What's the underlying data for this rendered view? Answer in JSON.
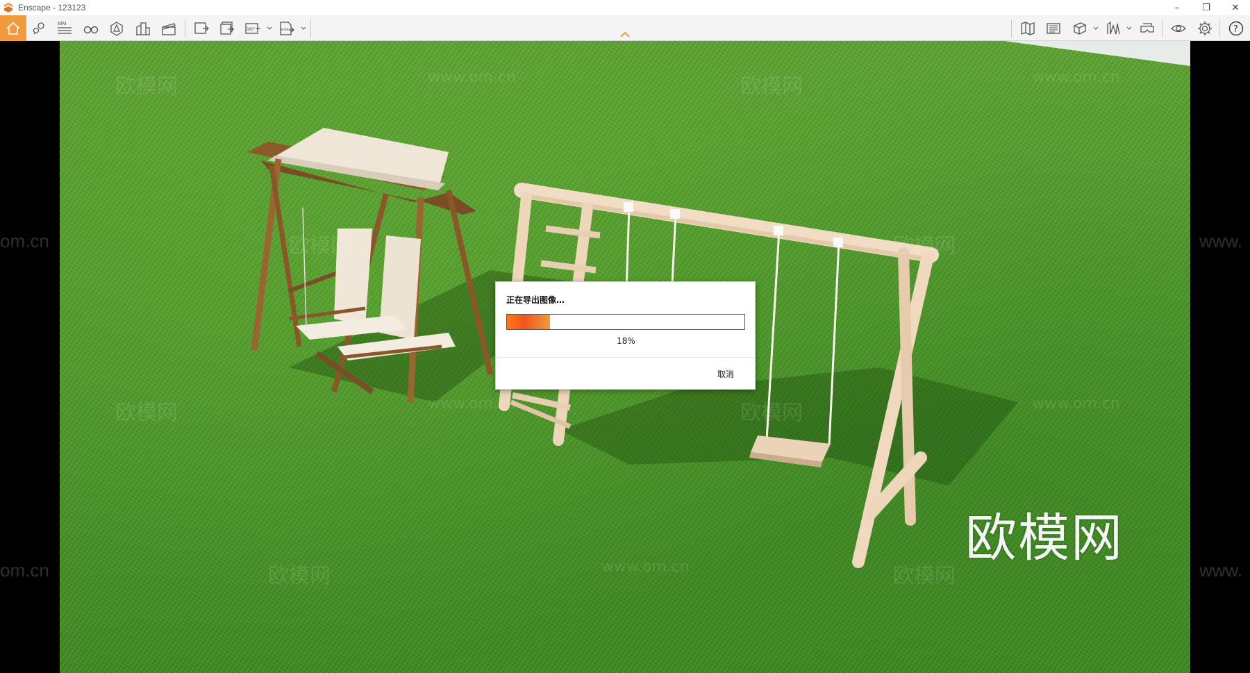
{
  "window": {
    "title": "Enscape - 123123",
    "app_icon": "enscape-logo-icon",
    "controls": {
      "minimize": "–",
      "restore": "❐",
      "close": "✕"
    }
  },
  "toolbar": {
    "left_icons": [
      "home-icon",
      "location-pin-icon",
      "bim-icon",
      "binoculars-icon",
      "visual-settings-icon",
      "building-icon",
      "clapper-icon",
      "screenshot-export-icon",
      "batch-export-icon",
      "panorama-360-icon",
      "exe-export-icon"
    ],
    "bim_label": "BIM",
    "pano_label": "360°",
    "exe_label": "EXE",
    "right_icons": [
      "map-icon",
      "views-icon",
      "cube-icon",
      "asset-library-icon",
      "vr-headset-icon",
      "eye-icon",
      "settings-gear-icon",
      "help-icon"
    ],
    "help_label": "?",
    "accent_color": "#f19a3e"
  },
  "viewport": {
    "watermark_big": "欧模网",
    "watermarks_faint": [
      "欧模网",
      "www.om.cn"
    ],
    "side_text_left": "om.cn",
    "side_text_right": "www."
  },
  "export_dialog": {
    "title": "正在导出图像…",
    "progress_percent": 18,
    "progress_label": "18%",
    "cancel_label": "取消"
  }
}
